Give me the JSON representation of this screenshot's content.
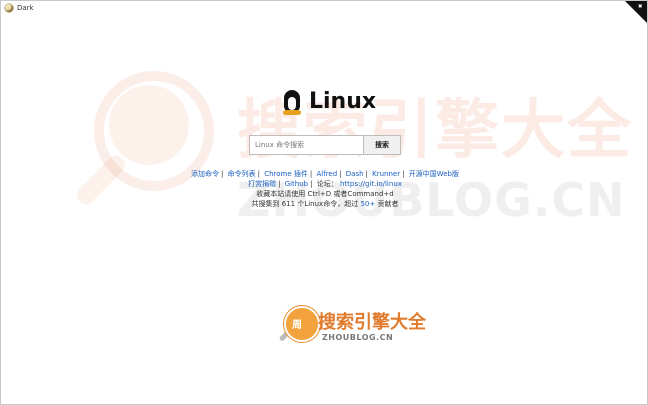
{
  "window": {
    "title": "Dark"
  },
  "header": {
    "title": "Linux"
  },
  "search": {
    "placeholder": "Linux 命令搜索",
    "button_label": "搜索"
  },
  "links_row1": [
    "添加命令",
    "命令列表",
    "Chrome 插件",
    "Alfred",
    "Dash",
    "Krunner",
    "开源中国Web版"
  ],
  "links_row2": {
    "items": [
      "打赏捐赠",
      "Github"
    ],
    "text_prefix": "论坛",
    "url": "https://git.io/linux"
  },
  "info": {
    "bookmark": "收藏本站请使用 Ctrl+D 或者Command+d",
    "stats_prefix": "共搜集到 611 个Linux命令，超过",
    "contributors": "50+",
    "stats_suffix": "贡献者"
  },
  "watermark": {
    "cn": "搜索引擎大全",
    "en": "ZHOUBLOG.CN"
  },
  "bottom_logo": {
    "cn": "搜索引擎大全",
    "en": "ZHOUBLOG.CN",
    "circle": "周"
  },
  "colors": {
    "link": "#1a5fc0",
    "accent": "#e07b2d"
  }
}
